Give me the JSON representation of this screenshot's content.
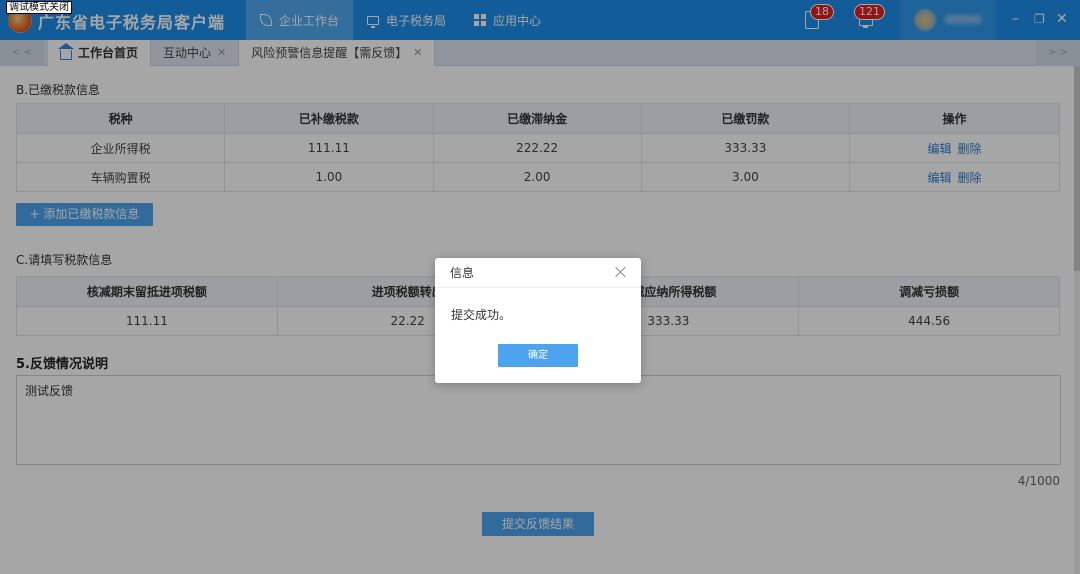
{
  "debug_tag": "调试模式关闭",
  "app": {
    "title": "广东省电子税务局客户端"
  },
  "topnav": [
    {
      "label": "企业工作台",
      "icon": "leaf-icon",
      "active": true
    },
    {
      "label": "电子税务局",
      "icon": "monitor-icon",
      "active": false
    },
    {
      "label": "应用中心",
      "icon": "grid-icon",
      "active": false
    }
  ],
  "notifications": {
    "docs_count": "18",
    "bell_count": "121"
  },
  "window_controls": {
    "minimize": "–",
    "maximize": "❐",
    "close": "✕"
  },
  "tabbar": {
    "scroll_left": "< <",
    "scroll_right": "> >",
    "tabs": [
      {
        "label": "工作台首页",
        "closable": false
      },
      {
        "label": "互动中心",
        "closable": true
      },
      {
        "label": "风险预警信息提醒【需反馈】",
        "closable": true
      }
    ],
    "close_glyph": "✕"
  },
  "section_b": {
    "title": "B.已缴税款信息",
    "headers": [
      "税种",
      "已补缴税款",
      "已缴滞纳金",
      "已缴罚款",
      "操作"
    ],
    "rows": [
      [
        "企业所得税",
        "111.11",
        "222.22",
        "333.33"
      ],
      [
        "车辆购置税",
        "1.00",
        "2.00",
        "3.00"
      ]
    ],
    "actions": {
      "edit": "编辑",
      "delete": "删除"
    },
    "add_button": "+ 添加已缴税款信息"
  },
  "section_c": {
    "title": "C.请填写税款信息",
    "headers": [
      "核减期末留抵进项税额",
      "进项税额转出",
      "核减应纳所得税额",
      "调减亏损额"
    ],
    "row": [
      "111.11",
      "22.22",
      "333.33",
      "444.56"
    ]
  },
  "feedback": {
    "title": "5.反馈情况说明",
    "value": "测试反馈",
    "counter": "4/1000",
    "submit_button": "提交反馈结果"
  },
  "dialog": {
    "title": "信息",
    "message": "提交成功。",
    "ok_button": "确定"
  }
}
